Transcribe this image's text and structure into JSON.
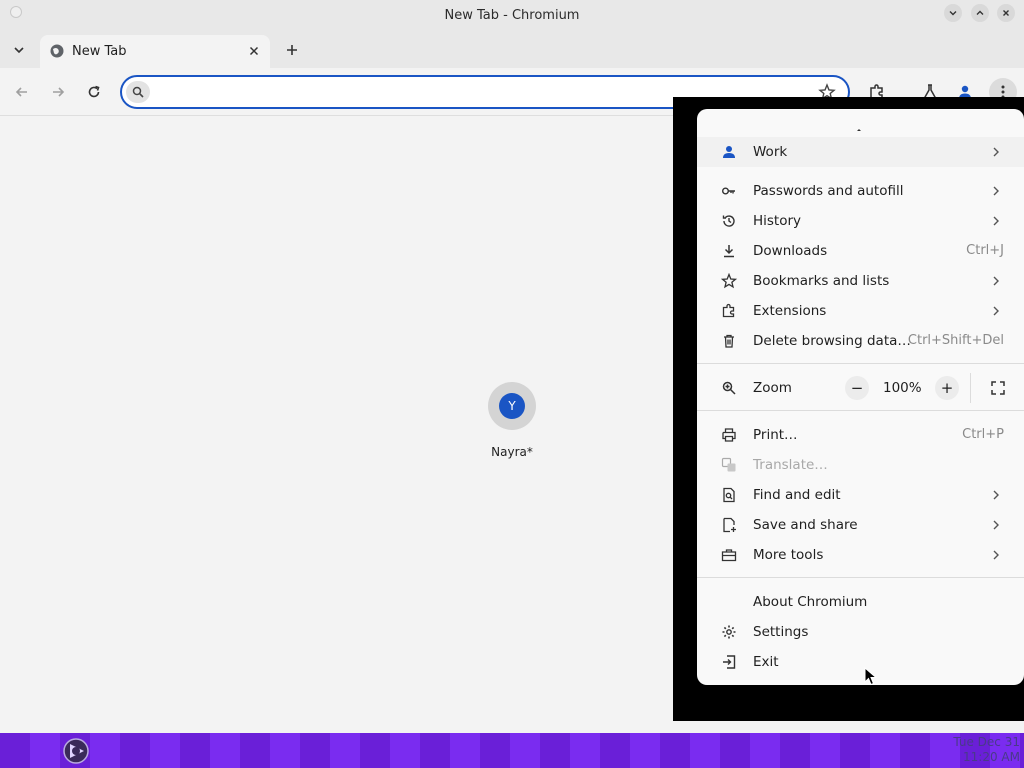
{
  "window": {
    "title": "New Tab - Chromium"
  },
  "tabs": [
    {
      "title": "New Tab"
    }
  ],
  "omnibox": {
    "value": "",
    "placeholder": ""
  },
  "content": {
    "profile_initial": "Y",
    "profile_name": "Nayra*"
  },
  "menu": {
    "profile_item": {
      "label": "Work",
      "icon": "person-icon",
      "submenu": true
    },
    "items_group1": [
      {
        "label": "Passwords and autofill",
        "icon": "key-icon",
        "submenu": true
      },
      {
        "label": "History",
        "icon": "history-icon",
        "submenu": true
      },
      {
        "label": "Downloads",
        "icon": "download-icon",
        "shortcut": "Ctrl+J"
      },
      {
        "label": "Bookmarks and lists",
        "icon": "star-icon",
        "submenu": true
      },
      {
        "label": "Extensions",
        "icon": "puzzle-icon",
        "submenu": true
      },
      {
        "label": "Delete browsing data…",
        "icon": "trash-icon",
        "shortcut": "Ctrl+Shift+Del"
      }
    ],
    "zoom": {
      "label": "Zoom",
      "value": "100%",
      "minus": "−",
      "plus": "+"
    },
    "items_group2": [
      {
        "label": "Print…",
        "icon": "printer-icon",
        "shortcut": "Ctrl+P"
      },
      {
        "label": "Translate…",
        "icon": "translate-icon",
        "disabled": true
      },
      {
        "label": "Find and edit",
        "icon": "find-icon",
        "submenu": true
      },
      {
        "label": "Save and share",
        "icon": "save-share-icon",
        "submenu": true
      },
      {
        "label": "More tools",
        "icon": "toolbox-icon",
        "submenu": true
      }
    ],
    "items_group3": [
      {
        "label": "About Chromium"
      },
      {
        "label": "Settings",
        "icon": "gear-icon"
      },
      {
        "label": "Exit",
        "icon": "exit-icon"
      }
    ]
  },
  "taskbar": {
    "clock_date": "Tue Dec 31",
    "clock_time": "11:20 AM"
  },
  "colors": {
    "accent": "#1a55c4",
    "taskbar": "#6a1fd8"
  }
}
